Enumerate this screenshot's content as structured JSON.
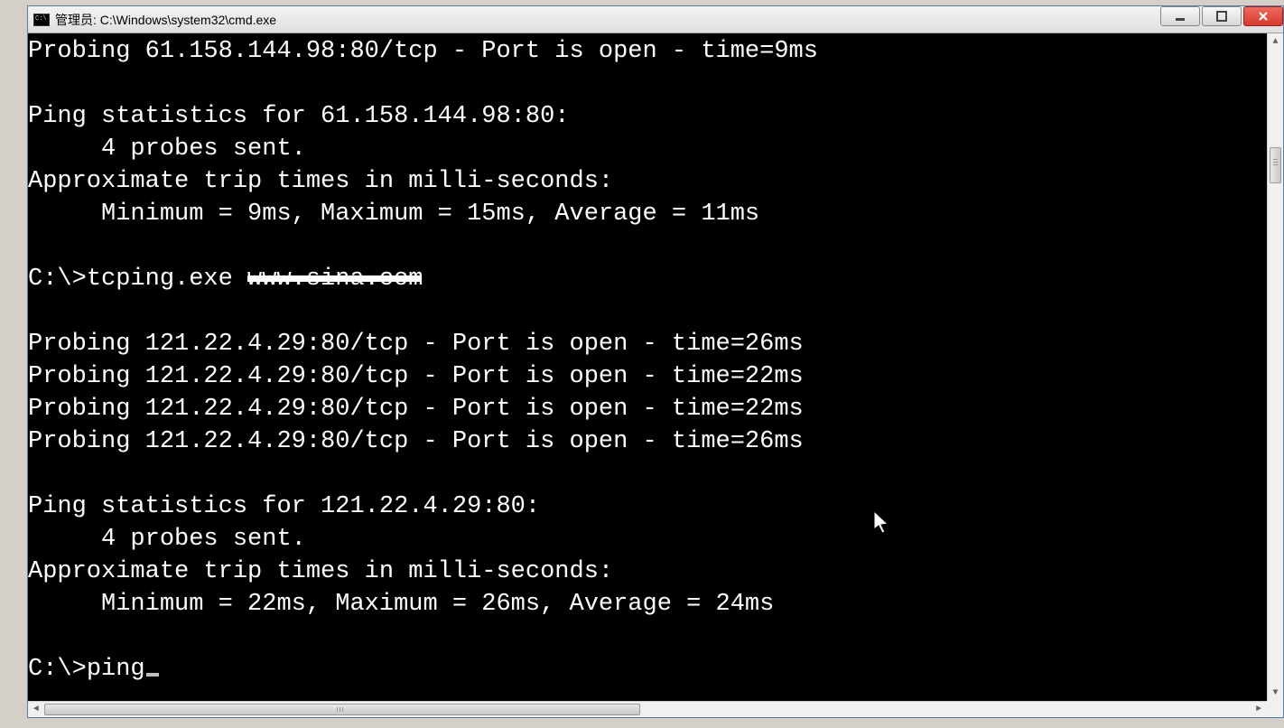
{
  "window": {
    "title": "管理员: C:\\Windows\\system32\\cmd.exe"
  },
  "terminal": {
    "lines": [
      "Probing 61.158.144.98:80/tcp - Port is open - time=9ms",
      "",
      "Ping statistics for 61.158.144.98:80:",
      "     4 probes sent.",
      "Approximate trip times in milli-seconds:",
      "     Minimum = 9ms, Maximum = 15ms, Average = 11ms",
      "",
      "",
      "",
      "Probing 121.22.4.29:80/tcp - Port is open - time=26ms",
      "Probing 121.22.4.29:80/tcp - Port is open - time=22ms",
      "Probing 121.22.4.29:80/tcp - Port is open - time=22ms",
      "Probing 121.22.4.29:80/tcp - Port is open - time=26ms",
      "",
      "Ping statistics for 121.22.4.29:80:",
      "     4 probes sent.",
      "Approximate trip times in milli-seconds:",
      "     Minimum = 22ms, Maximum = 26ms, Average = 24ms",
      ""
    ],
    "command_line": {
      "prompt": "C:\\>",
      "prev_command_prefix": "tcping.exe ",
      "prev_command_redacted": "www.sina.com",
      "current_command": "ping"
    }
  }
}
